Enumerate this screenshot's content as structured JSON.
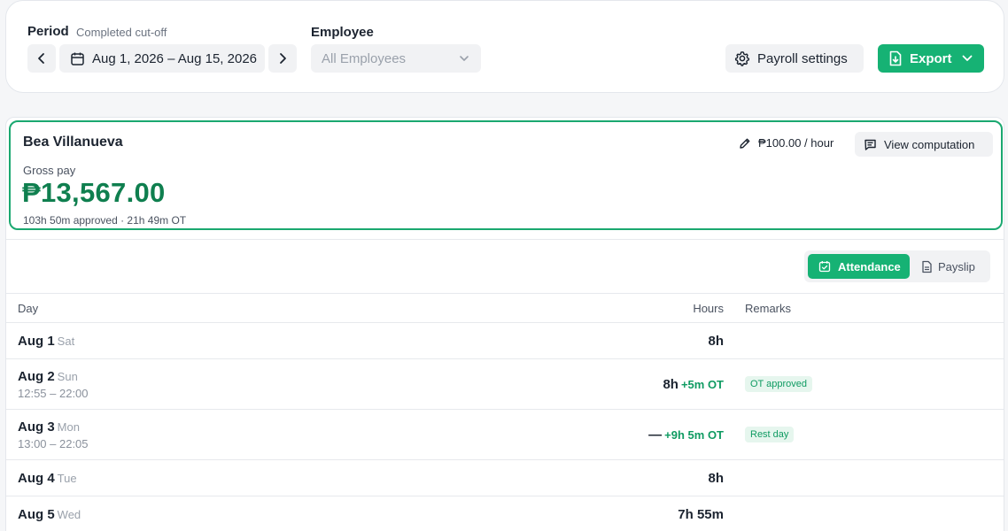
{
  "filters": {
    "period_label": "Period",
    "period_status": "Completed cut-off",
    "date_range": "Aug 1, 2026 – Aug 15, 2026",
    "employee_label": "Employee",
    "employee_selected": "All Employees",
    "payroll_settings": "Payroll settings",
    "export": "Export"
  },
  "employee": {
    "name": "Bea Villanueva",
    "rate": "₱100.00 / hour",
    "view_computation": "View computation",
    "gross_label": "Gross pay",
    "gross_value": "₱13,567.00",
    "summary": "103h 50m approved · 21h 49m OT"
  },
  "tabs": {
    "attendance": "Attendance",
    "payslip": "Payslip"
  },
  "table": {
    "headers": {
      "day": "Day",
      "hours": "Hours",
      "remarks": "Remarks"
    },
    "rows": [
      {
        "day": "Aug 1",
        "dow": "Sat",
        "times": "",
        "hours": "8h",
        "ot": "",
        "remark": ""
      },
      {
        "day": "Aug 2",
        "dow": "Sun",
        "times": "12:55 – 22:00",
        "hours": "8h",
        "ot": "+5m OT",
        "remark": "OT approved"
      },
      {
        "day": "Aug 3",
        "dow": "Mon",
        "times": "13:00 – 22:05",
        "hours": "—",
        "ot": "+9h 5m OT",
        "remark": "Rest day"
      },
      {
        "day": "Aug 4",
        "dow": "Tue",
        "times": "",
        "hours": "8h",
        "ot": "",
        "remark": ""
      },
      {
        "day": "Aug 5",
        "dow": "Wed",
        "times": "",
        "hours": "7h 55m",
        "ot": "",
        "remark": ""
      }
    ]
  },
  "colors": {
    "accent": "#16b274",
    "money": "#0f7f4f",
    "ot": "#0f9b62",
    "badge_bg": "#e6f6ee"
  },
  "icons": [
    "chevron-left-icon",
    "calendar-icon",
    "chevron-right-icon",
    "chevron-down-icon",
    "gear-icon",
    "file-export-icon",
    "pencil-icon",
    "message-icon",
    "calendar-check-icon",
    "document-icon"
  ]
}
